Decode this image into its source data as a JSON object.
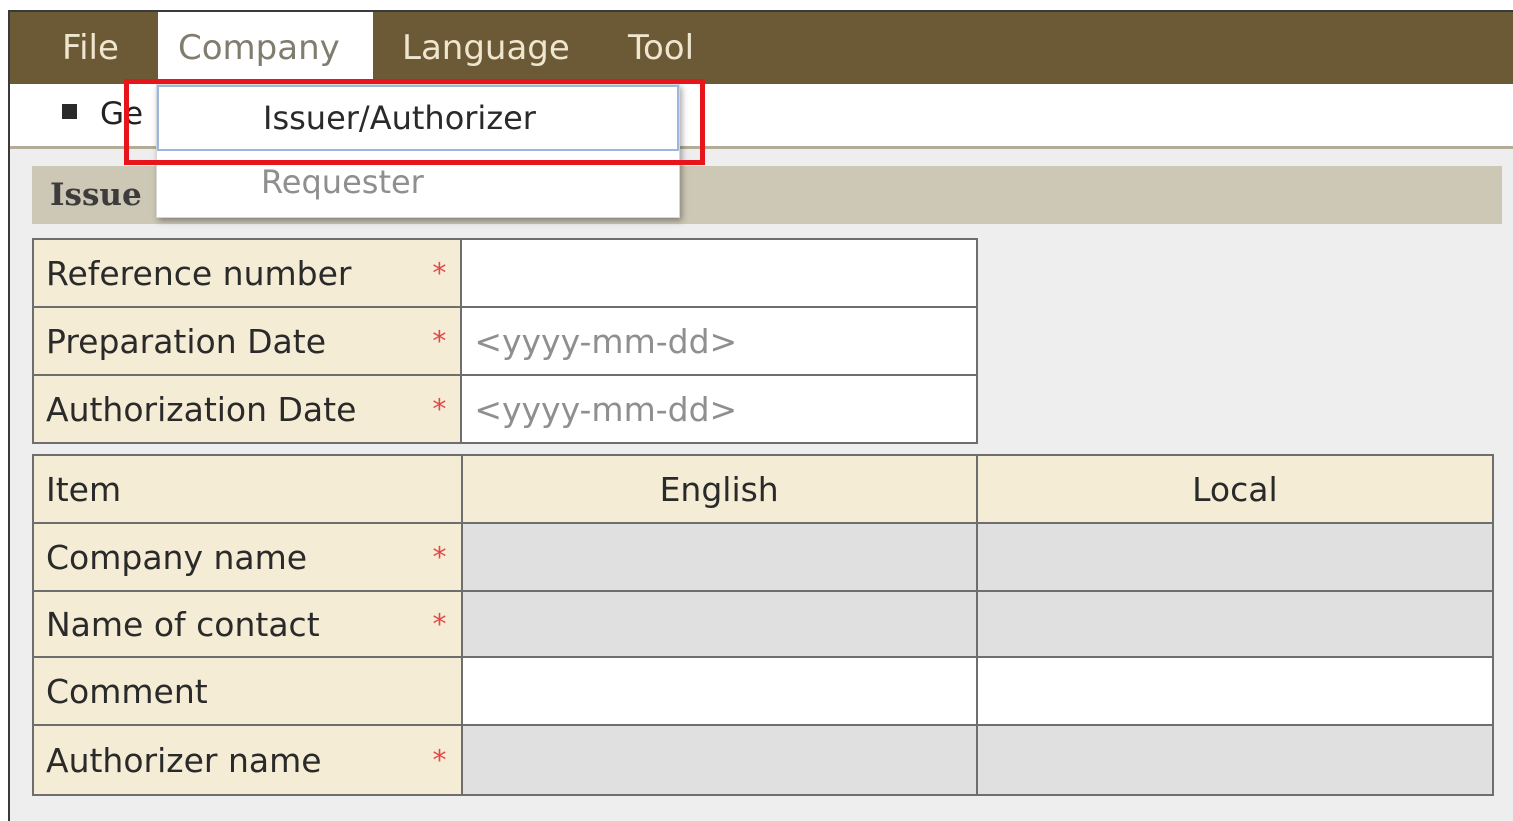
{
  "menubar": {
    "items": [
      {
        "label": "File"
      },
      {
        "label": "Company"
      },
      {
        "label": "Language"
      },
      {
        "label": "Tool"
      }
    ]
  },
  "subbar": {
    "label": "Ge"
  },
  "section": {
    "title": "Issue"
  },
  "dropdown": {
    "items": [
      {
        "label": "Issuer/Authorizer",
        "state": "selected"
      },
      {
        "label": "Requester",
        "state": "disabled"
      }
    ]
  },
  "top_form": {
    "rows": [
      {
        "label": "Reference number",
        "required": "*",
        "value": ""
      },
      {
        "label": "Preparation Date",
        "required": "*",
        "value": "<yyyy-mm-dd>"
      },
      {
        "label": "Authorization Date",
        "required": "*",
        "value": "<yyyy-mm-dd>"
      }
    ]
  },
  "item_table": {
    "headers": [
      "Item",
      "English",
      "Local"
    ],
    "rows": [
      {
        "label": "Company name",
        "required": "*"
      },
      {
        "label": "Name of contact",
        "required": "*"
      },
      {
        "label": "Comment",
        "required": ""
      },
      {
        "label": "Authorizer name",
        "required": "*"
      }
    ]
  },
  "colors": {
    "menubar": "#6c5a36",
    "label_bg": "#f5ecd6",
    "highlight": "#e8141b",
    "required": "#e04848"
  }
}
